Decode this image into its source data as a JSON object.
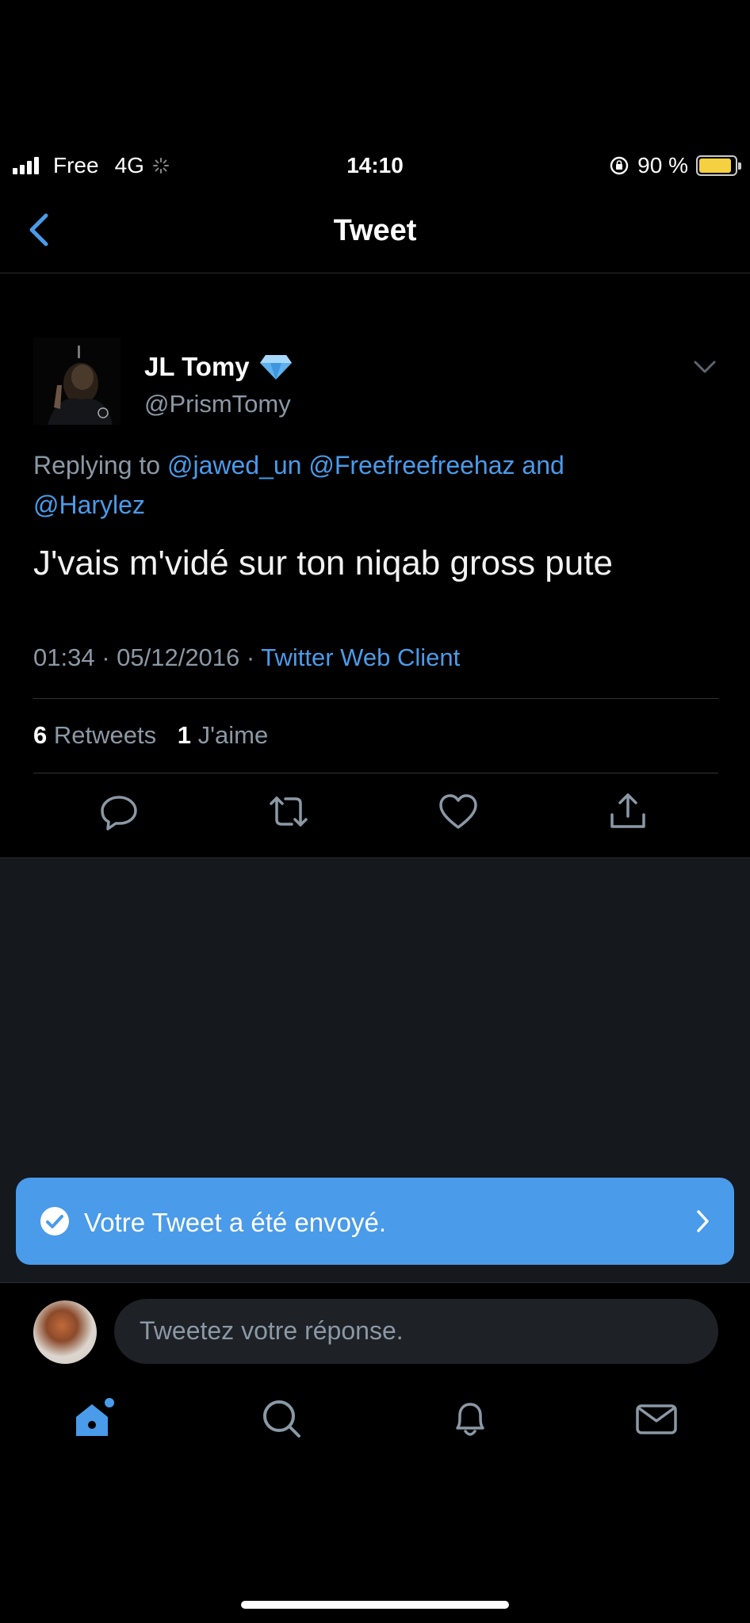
{
  "status_bar": {
    "carrier": "Free",
    "network": "4G",
    "time": "14:10",
    "battery": "90 %",
    "battery_level": 0.9
  },
  "header": {
    "title": "Tweet"
  },
  "tweet": {
    "name": "JL Tomy",
    "handle": "@PrismTomy",
    "replying_prefix": "Replying to",
    "reply_mentions_1": "@jawed_un @Freefreefreehaz",
    "reply_and": "and",
    "reply_mentions_2": "@Harylez",
    "text": "J'vais m'vidé sur ton niqab gross pute",
    "time": "01:34 · 05/12/2016 ·",
    "client": "Twitter Web Client",
    "retweets_count": "6",
    "retweets_label": "Retweets",
    "likes_count": "1",
    "likes_label": "J'aime"
  },
  "toast": {
    "message": "Votre Tweet a été envoyé."
  },
  "reply_bar": {
    "placeholder": "Tweetez votre réponse."
  },
  "colors": {
    "accent": "#4a9be9",
    "secondary_text": "#8b98a5",
    "battery": "#f5d040"
  }
}
